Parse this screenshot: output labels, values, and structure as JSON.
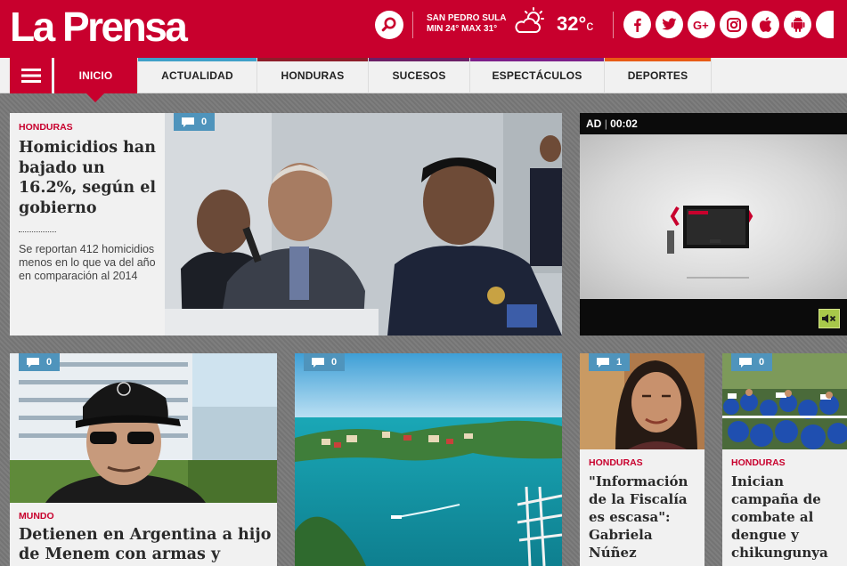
{
  "header": {
    "logo": "La Prensa",
    "weather": {
      "city": "SAN PEDRO SULA",
      "minmax": "MIN 24° MAX 31°",
      "temp": "32°",
      "unit": "c"
    }
  },
  "nav": {
    "items": [
      {
        "label": "INICIO",
        "active": true,
        "color": "#c8002d"
      },
      {
        "label": "ACTUALIDAD",
        "color": "#3fa0c8"
      },
      {
        "label": "HONDURAS",
        "color": "#8e1d2a"
      },
      {
        "label": "SUCESOS",
        "color": "#6b1f66"
      },
      {
        "label": "ESPECTÁCULOS",
        "color": "#7c1f8a"
      },
      {
        "label": "DEPORTES",
        "color": "#e85b15"
      }
    ]
  },
  "featured": {
    "section": "HONDURAS",
    "headline": "Homicidios han bajado un 16.2%, según el gobierno",
    "summary": "Se reportan 412 homicidios menos en lo que va del año en comparación al 2014",
    "comments": "0"
  },
  "ad": {
    "label": "AD",
    "time": "00:02"
  },
  "cards": [
    {
      "section": "MUNDO",
      "headline": "Detienen en Argentina a hijo de Menem con armas y drogas",
      "comments": "0"
    },
    {
      "section": "",
      "headline": "",
      "comments": "0"
    },
    {
      "section": "HONDURAS",
      "headline": "\"Información de la Fiscalía es escasa\": Gabriela Núñez",
      "comments": "1"
    },
    {
      "section": "HONDURAS",
      "headline": "Inician campaña de combate al dengue y chikungunya",
      "comments": "0"
    }
  ],
  "colors": {
    "brand": "#c8002d",
    "comment_badge": "#4f94bc"
  }
}
